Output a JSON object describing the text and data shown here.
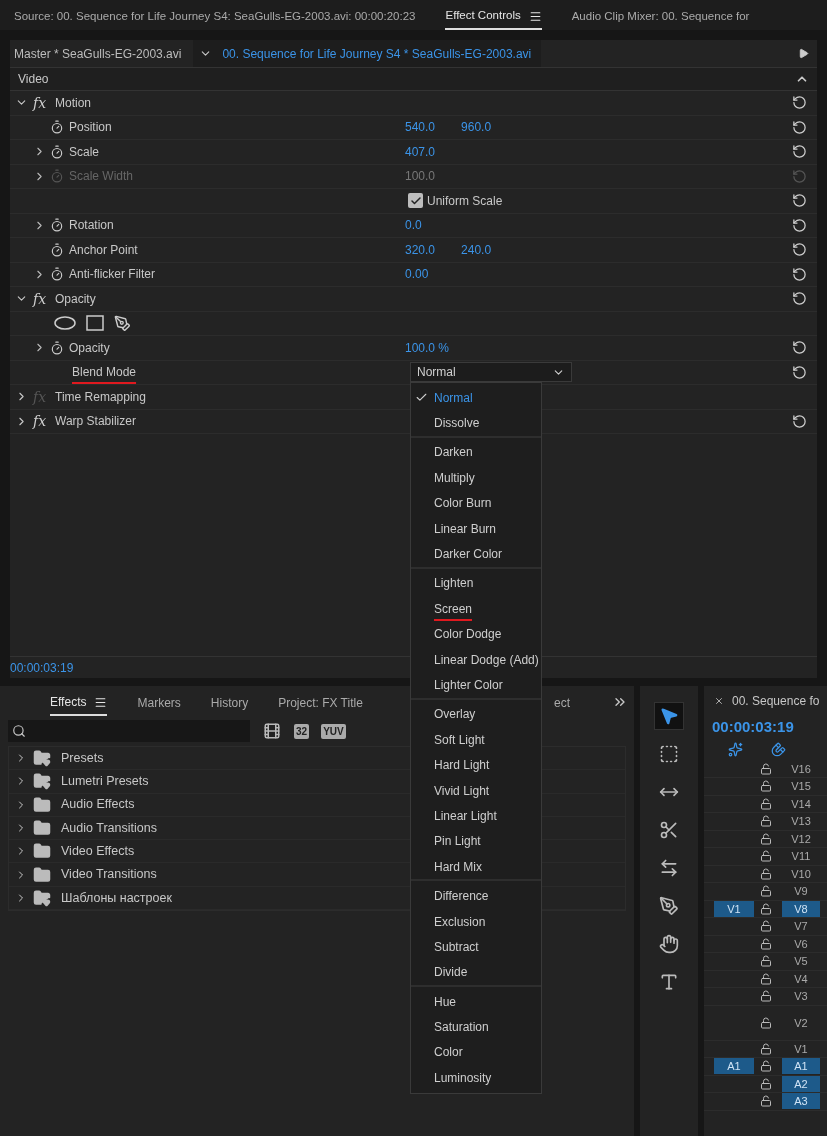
{
  "panel_tabs": [
    {
      "label": "Source: 00. Sequence for Life Journey S4: SeaGulls-EG-2003.avi: 00:00:20:23",
      "selected": false,
      "menu": false
    },
    {
      "label": "Effect Controls",
      "selected": true,
      "menu": true
    },
    {
      "label": "Audio Clip Mixer: 00. Sequence for",
      "selected": false,
      "menu": false
    }
  ],
  "effect_controls": {
    "master_clip": "Master * SeaGulls-EG-2003.avi",
    "sequence_clip": "00. Sequence for Life Journey S4 * SeaGulls-EG-2003.avi",
    "section": "Video",
    "effects": [
      {
        "icon": "fx",
        "name": "Motion",
        "expanded": true,
        "enabled": true,
        "resettable": true,
        "properties": [
          {
            "kind": "value",
            "name": "Position",
            "expandable": false,
            "disabled": false,
            "values": [
              "540.0",
              "960.0"
            ]
          },
          {
            "kind": "value",
            "name": "Scale",
            "expandable": true,
            "disabled": false,
            "values": [
              "407.0"
            ]
          },
          {
            "kind": "value",
            "name": "Scale Width",
            "expandable": true,
            "disabled": true,
            "values": [
              "100.0"
            ]
          },
          {
            "kind": "checkbox",
            "label": "Uniform Scale",
            "checked": true
          },
          {
            "kind": "value",
            "name": "Rotation",
            "expandable": true,
            "disabled": false,
            "values": [
              "0.0"
            ]
          },
          {
            "kind": "value",
            "name": "Anchor Point",
            "expandable": false,
            "disabled": false,
            "values": [
              "320.0",
              "240.0"
            ]
          },
          {
            "kind": "value",
            "name": "Anti-flicker Filter",
            "expandable": true,
            "disabled": false,
            "values": [
              "0.00"
            ]
          }
        ]
      },
      {
        "icon": "fx",
        "name": "Opacity",
        "expanded": true,
        "enabled": true,
        "resettable": true,
        "properties": [
          {
            "kind": "mask-tools"
          },
          {
            "kind": "value",
            "name": "Opacity",
            "expandable": true,
            "disabled": false,
            "values": [
              "100.0 %"
            ]
          },
          {
            "kind": "dropdown",
            "name": "Blend Mode",
            "underlined": true,
            "value": "Normal",
            "open": true
          }
        ]
      },
      {
        "icon": "fx",
        "name": "Time Remapping",
        "expanded": false,
        "enabled": false,
        "resettable": false
      },
      {
        "icon": "fx",
        "name": "Warp Stabilizer",
        "expanded": false,
        "enabled": true,
        "resettable": true
      }
    ],
    "timecode": "00:00:03:19"
  },
  "blend_menu": [
    [
      {
        "label": "Normal",
        "selected": true,
        "underlined": false
      },
      {
        "label": "Dissolve",
        "selected": false,
        "underlined": false
      }
    ],
    [
      {
        "label": "Darken",
        "selected": false,
        "underlined": false
      },
      {
        "label": "Multiply",
        "selected": false,
        "underlined": false
      },
      {
        "label": "Color Burn",
        "selected": false,
        "underlined": false
      },
      {
        "label": "Linear Burn",
        "selected": false,
        "underlined": false
      },
      {
        "label": "Darker Color",
        "selected": false,
        "underlined": false
      }
    ],
    [
      {
        "label": "Lighten",
        "selected": false,
        "underlined": false
      },
      {
        "label": "Screen",
        "selected": false,
        "underlined": true
      },
      {
        "label": "Color Dodge",
        "selected": false,
        "underlined": false
      },
      {
        "label": "Linear Dodge (Add)",
        "selected": false,
        "underlined": false
      },
      {
        "label": "Lighter Color",
        "selected": false,
        "underlined": false
      }
    ],
    [
      {
        "label": "Overlay",
        "selected": false,
        "underlined": false
      },
      {
        "label": "Soft Light",
        "selected": false,
        "underlined": false
      },
      {
        "label": "Hard Light",
        "selected": false,
        "underlined": false
      },
      {
        "label": "Vivid Light",
        "selected": false,
        "underlined": false
      },
      {
        "label": "Linear Light",
        "selected": false,
        "underlined": false
      },
      {
        "label": "Pin Light",
        "selected": false,
        "underlined": false
      },
      {
        "label": "Hard Mix",
        "selected": false,
        "underlined": false
      }
    ],
    [
      {
        "label": "Difference",
        "selected": false,
        "underlined": false
      },
      {
        "label": "Exclusion",
        "selected": false,
        "underlined": false
      },
      {
        "label": "Subtract",
        "selected": false,
        "underlined": false
      },
      {
        "label": "Divide",
        "selected": false,
        "underlined": false
      }
    ],
    [
      {
        "label": "Hue",
        "selected": false,
        "underlined": false
      },
      {
        "label": "Saturation",
        "selected": false,
        "underlined": false
      },
      {
        "label": "Color",
        "selected": false,
        "underlined": false
      },
      {
        "label": "Luminosity",
        "selected": false,
        "underlined": false
      }
    ]
  ],
  "bottom_tabs": [
    {
      "label": "Effects",
      "selected": true,
      "menu": true
    },
    {
      "label": "Markers",
      "selected": false,
      "menu": false
    },
    {
      "label": "History",
      "selected": false,
      "menu": false
    },
    {
      "label": "Project: FX Title",
      "selected": false,
      "menu": false
    },
    {
      "label": "ect",
      "selected": false,
      "menu": false
    }
  ],
  "effects_filters": [
    "32",
    "YUV"
  ],
  "effects_tree": [
    {
      "label": "Presets",
      "kind": "preset-folder"
    },
    {
      "label": "Lumetri Presets",
      "kind": "preset-folder"
    },
    {
      "label": "Audio Effects",
      "kind": "folder"
    },
    {
      "label": "Audio Transitions",
      "kind": "folder"
    },
    {
      "label": "Video Effects",
      "kind": "folder"
    },
    {
      "label": "Video Transitions",
      "kind": "folder"
    },
    {
      "label": "Шаблоны настроек",
      "kind": "preset-folder"
    }
  ],
  "tools": [
    {
      "kind": "selection",
      "selected": true
    },
    {
      "kind": "track-select",
      "selected": false
    },
    {
      "kind": "ripple",
      "selected": false
    },
    {
      "kind": "razor",
      "selected": false
    },
    {
      "kind": "slip",
      "selected": false
    },
    {
      "kind": "pen",
      "selected": false
    },
    {
      "kind": "hand",
      "selected": false
    },
    {
      "kind": "type",
      "selected": false
    }
  ],
  "timeline": {
    "title": "00. Sequence fo",
    "timecode": "00:00:03:19",
    "tracks": [
      {
        "label": "V16",
        "targeted": false,
        "tall": false
      },
      {
        "label": "V15",
        "targeted": false,
        "tall": false
      },
      {
        "label": "V14",
        "targeted": false,
        "tall": false
      },
      {
        "label": "V13",
        "targeted": false,
        "tall": false
      },
      {
        "label": "V12",
        "targeted": false,
        "tall": false
      },
      {
        "label": "V11",
        "targeted": false,
        "tall": false
      },
      {
        "label": "V10",
        "targeted": false,
        "tall": false
      },
      {
        "label": "V9",
        "targeted": false,
        "tall": false
      },
      {
        "label": "V8",
        "source": "V1",
        "targeted": true,
        "tall": false
      },
      {
        "label": "V7",
        "targeted": false,
        "tall": false
      },
      {
        "label": "V6",
        "targeted": false,
        "tall": false
      },
      {
        "label": "V5",
        "targeted": false,
        "tall": false
      },
      {
        "label": "V4",
        "targeted": false,
        "tall": false
      },
      {
        "label": "V3",
        "targeted": false,
        "tall": false
      },
      {
        "label": "V2",
        "targeted": false,
        "tall": true
      },
      {
        "label": "V1",
        "targeted": false,
        "tall": false
      },
      {
        "label": "A1",
        "source": "A1",
        "targeted": true,
        "tall": false
      },
      {
        "label": "A2",
        "targeted": true,
        "tall": false
      },
      {
        "label": "A3",
        "targeted": true,
        "tall": false
      }
    ]
  }
}
